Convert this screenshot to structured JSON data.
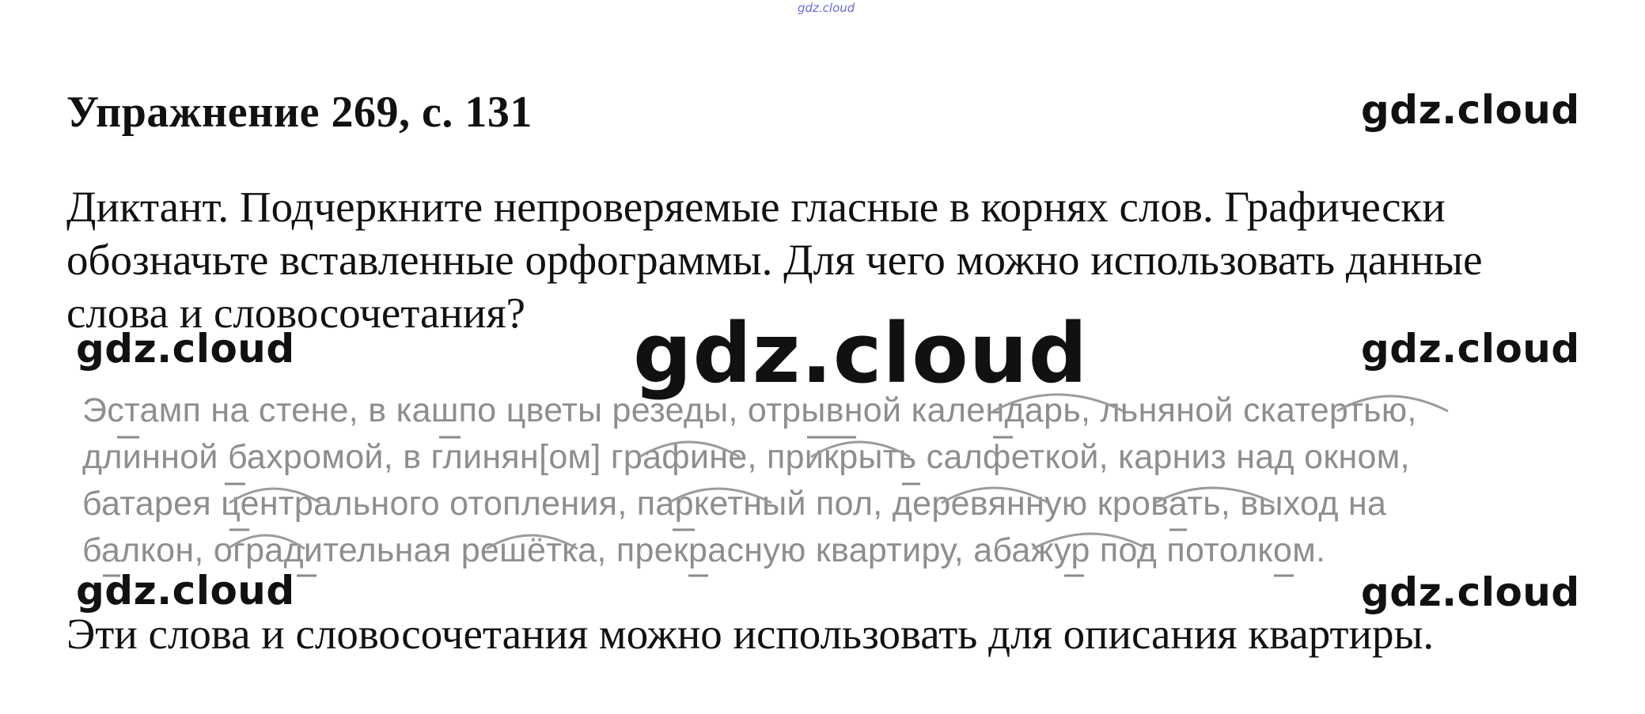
{
  "page": {
    "top_watermark": "gdz.cloud",
    "title": "Упражнение 269, с. 131",
    "task_lines": [
      "Диктант. Подчеркните непроверяемые гласные в корнях слов. Графически",
      "обозначьте вставленные орфограммы. Для чего можно использовать данные",
      "слова и словосочетания?"
    ],
    "watermarks": {
      "top_right": "gdz.cloud",
      "mid_left": "gdz.cloud",
      "center_big": "gdz.cloud",
      "mid_right": "gdz.cloud",
      "bottom_left": "gdz.cloud",
      "bottom_right": "gdz.cloud"
    },
    "dictation_lines": [
      "Эстамп на стене, в кашпо цветы резеды, отрывной календарь, льняной скатертью,",
      "длинной бахромой, в глинян[ом] графине, прикрыть салфеткой, карниз над окном,",
      "батарея центрального отопления, паркетный пол, деревянную кровать, выход на",
      "балкон, оградительная решётка, прекрасную квартиру, абажур под потолком."
    ],
    "answer": "Эти слова и словосочетания можно использовать для описания квартиры."
  },
  "colors": {
    "text": "#111111",
    "dictation_text": "#8e8e8e",
    "top_watermark": "#6a6ad8",
    "background": "#ffffff"
  }
}
